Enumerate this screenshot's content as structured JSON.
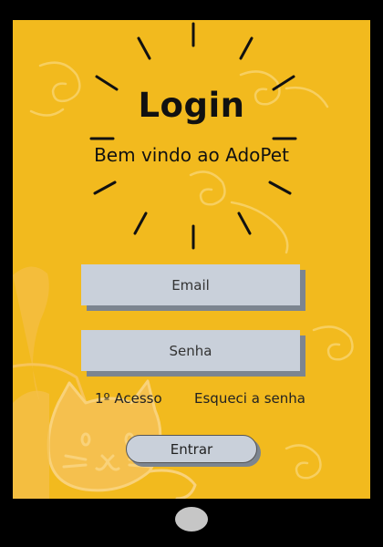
{
  "login": {
    "title": "Login",
    "subtitle": "Bem vindo ao AdoPet",
    "email_placeholder": "Email",
    "password_placeholder": "Senha",
    "first_access_link": "1º Acesso",
    "forgot_password_link": "Esqueci a senha",
    "submit_label": "Entrar"
  },
  "colors": {
    "screen_background": "#F2BA1E",
    "device_frame": "#000000",
    "field_background": "#C9D0DA",
    "field_shadow": "#7C8590",
    "decoration": "#F7CF60",
    "cat_illustration": "#F7C45A",
    "home_button": "#C6C6C6"
  },
  "icons": {
    "background": "swirl-pattern",
    "decoration": "sunburst-rays",
    "illustration": "cat-illustration"
  }
}
